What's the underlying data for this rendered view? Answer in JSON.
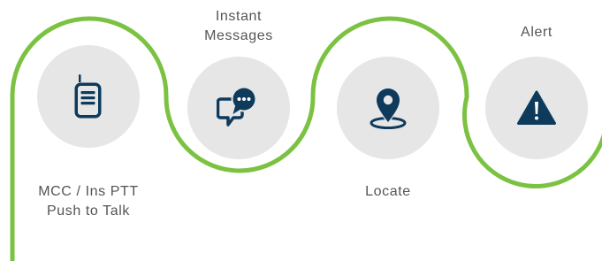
{
  "colors": {
    "accent_line": "#7cc242",
    "circle_fill": "#e6e6e6",
    "icon_fill": "#0e3a5c",
    "label_text": "#555555"
  },
  "steps": [
    {
      "icon": "walkie-talkie-icon",
      "label_lines": [
        "MCC / Ins PTT",
        "Push to Talk"
      ]
    },
    {
      "icon": "chat-bubbles-icon",
      "label_lines": [
        "Instant",
        "Messages"
      ]
    },
    {
      "icon": "location-pin-icon",
      "label_lines": [
        "Locate"
      ]
    },
    {
      "icon": "warning-triangle-icon",
      "label_lines": [
        "Alert"
      ]
    }
  ]
}
